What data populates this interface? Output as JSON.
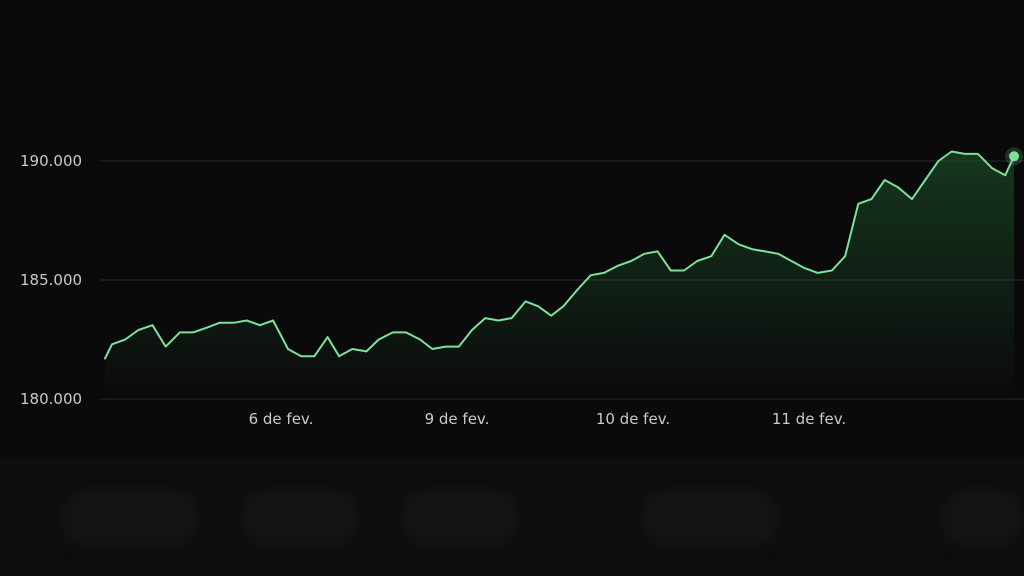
{
  "chart_data": {
    "type": "area",
    "title": "",
    "xlabel": "",
    "ylabel": "",
    "ylim": [
      180000,
      190000
    ],
    "yticks": [
      {
        "value": 180000,
        "label": "180.000"
      },
      {
        "value": 185000,
        "label": "185.000"
      },
      {
        "value": 190000,
        "label": "190.000"
      }
    ],
    "xlim": [
      0,
      100
    ],
    "xticks": [
      {
        "x": 20,
        "label": "6 de fev."
      },
      {
        "x": 40,
        "label": "9 de fev."
      },
      {
        "x": 60,
        "label": "10 de fev."
      },
      {
        "x": 80,
        "label": "11 de fev."
      }
    ],
    "grid": true,
    "line_color": "#7ee09a",
    "fill_color": "#1f5a2e",
    "last_point_marker": true,
    "series": [
      {
        "points": [
          [
            0.0,
            181700
          ],
          [
            0.8,
            182300
          ],
          [
            2.3,
            182500
          ],
          [
            3.8,
            182900
          ],
          [
            5.4,
            183100
          ],
          [
            6.9,
            182200
          ],
          [
            8.5,
            182800
          ],
          [
            10.0,
            182800
          ],
          [
            11.6,
            183000
          ],
          [
            13.0,
            183200
          ],
          [
            14.6,
            183200
          ],
          [
            16.1,
            183300
          ],
          [
            17.6,
            183100
          ],
          [
            19.1,
            183300
          ],
          [
            20.8,
            182100
          ],
          [
            22.3,
            181800
          ],
          [
            23.8,
            181800
          ],
          [
            25.3,
            182600
          ],
          [
            26.6,
            181800
          ],
          [
            28.1,
            182100
          ],
          [
            29.7,
            182000
          ],
          [
            31.1,
            182500
          ],
          [
            32.7,
            182800
          ],
          [
            34.2,
            182800
          ],
          [
            35.8,
            182500
          ],
          [
            37.2,
            182100
          ],
          [
            38.7,
            182200
          ],
          [
            40.2,
            182200
          ],
          [
            41.7,
            182900
          ],
          [
            43.2,
            183400
          ],
          [
            44.7,
            183300
          ],
          [
            46.2,
            183400
          ],
          [
            47.8,
            184100
          ],
          [
            49.2,
            183900
          ],
          [
            50.7,
            183500
          ],
          [
            52.1,
            183900
          ],
          [
            53.7,
            184600
          ],
          [
            55.2,
            185200
          ],
          [
            56.7,
            185300
          ],
          [
            58.3,
            185600
          ],
          [
            59.8,
            185800
          ],
          [
            61.3,
            186100
          ],
          [
            62.8,
            186200
          ],
          [
            64.3,
            185400
          ],
          [
            65.8,
            185400
          ],
          [
            67.3,
            185800
          ],
          [
            68.9,
            186000
          ],
          [
            70.4,
            186900
          ],
          [
            72.0,
            186500
          ],
          [
            73.5,
            186300
          ],
          [
            75.0,
            186200
          ],
          [
            76.5,
            186100
          ],
          [
            78.0,
            185800
          ],
          [
            79.5,
            185500
          ],
          [
            81.0,
            185300
          ],
          [
            82.6,
            185400
          ],
          [
            84.1,
            186000
          ],
          [
            85.6,
            188200
          ],
          [
            87.1,
            188400
          ],
          [
            88.6,
            189200
          ],
          [
            90.1,
            188900
          ],
          [
            91.7,
            188400
          ],
          [
            93.2,
            189200
          ],
          [
            94.7,
            190000
          ],
          [
            96.2,
            190400
          ],
          [
            97.7,
            190300
          ],
          [
            99.2,
            190300
          ],
          [
            100.8,
            189700
          ],
          [
            102.3,
            189400
          ],
          [
            103.3,
            190200
          ]
        ]
      }
    ]
  }
}
